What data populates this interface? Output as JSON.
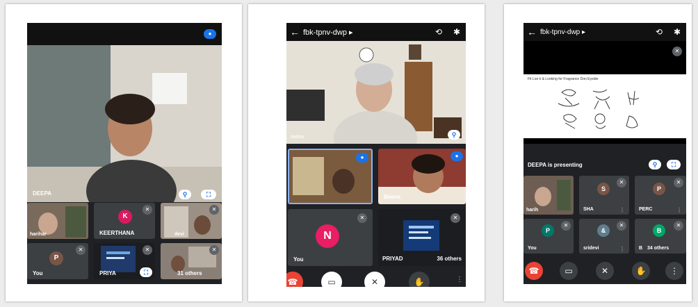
{
  "phone1": {
    "presenter_name": "DEEPA",
    "tiles": [
      {
        "name": "harihar"
      },
      {
        "name": "KEERTHANA",
        "initial": "K",
        "color": "#d81b60"
      },
      {
        "name": "devi"
      },
      {
        "name": "You",
        "initial": "P",
        "color": "#795548"
      },
      {
        "name": "PRIYA"
      },
      {
        "name": "31 others"
      }
    ]
  },
  "phone2": {
    "meeting_code": "fbk-tpnv-dwp",
    "main_name": "Indira",
    "tiles": [
      {
        "name": ""
      },
      {
        "name": "Beena"
      },
      {
        "name": "You",
        "initial": "N",
        "color": "#e91e63"
      },
      {
        "name": "PRIYAD",
        "extra": "36 others"
      }
    ]
  },
  "phone3": {
    "meeting_code": "fbk-tpnv-dwp",
    "presenting_text": "DEEPA is presenting",
    "doc_caption": "Fit Loo k & Looking for Fragrance Don Eyedie",
    "tiles": [
      {
        "name": "harih"
      },
      {
        "name": "SHA",
        "initial": "S",
        "color": "#795548"
      },
      {
        "name": "PERC",
        "initial": "P",
        "color": "#795548"
      },
      {
        "name": "You",
        "initial": "P",
        "color": "#00796b"
      },
      {
        "name": "sridevi",
        "initial": "&",
        "color": "#607d8b"
      },
      {
        "name": "B",
        "initial": "B",
        "color": "#00a86b",
        "extra": "34 others"
      }
    ]
  },
  "icons": {
    "back": "←",
    "triangle": "▸",
    "switch_camera": "⟲",
    "bluetooth": "✱",
    "mic_off": "✕",
    "pin": "⚲",
    "fullscreen": "⛶",
    "more": "⋮",
    "end_call": "☎",
    "camera_off": "▭",
    "raise_hand": "✋"
  }
}
